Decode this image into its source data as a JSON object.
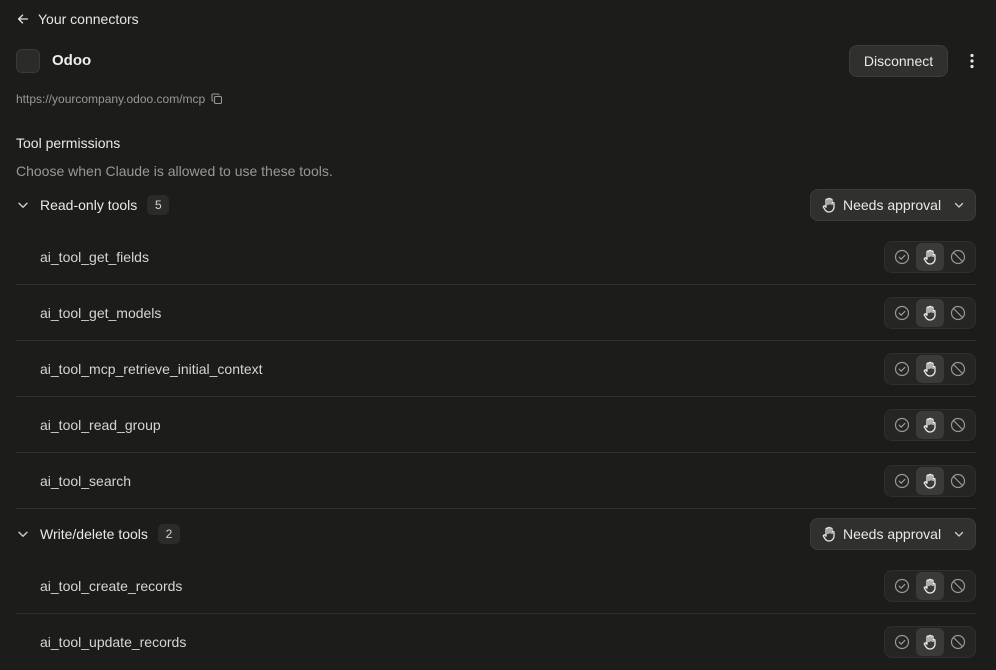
{
  "nav": {
    "back_label": "Your connectors"
  },
  "connector": {
    "name": "Odoo",
    "disconnect_label": "Disconnect",
    "url": "https://yourcompany.odoo.com/mcp"
  },
  "permissions": {
    "title": "Tool permissions",
    "subtitle": "Choose when Claude is allowed to use these tools."
  },
  "groups": [
    {
      "label": "Read-only tools",
      "count": "5",
      "policy": "Needs approval",
      "tools": [
        {
          "name": "ai_tool_get_fields",
          "selected": "approval"
        },
        {
          "name": "ai_tool_get_models",
          "selected": "approval"
        },
        {
          "name": "ai_tool_mcp_retrieve_initial_context",
          "selected": "approval"
        },
        {
          "name": "ai_tool_read_group",
          "selected": "approval"
        },
        {
          "name": "ai_tool_search",
          "selected": "approval"
        }
      ]
    },
    {
      "label": "Write/delete tools",
      "count": "2",
      "policy": "Needs approval",
      "tools": [
        {
          "name": "ai_tool_create_records",
          "selected": "approval"
        },
        {
          "name": "ai_tool_update_records",
          "selected": "approval"
        }
      ]
    }
  ],
  "icons": {
    "back": "arrow-left-icon",
    "more": "vertical-dots-icon",
    "copy": "copy-icon",
    "expand": "chevron-down-icon",
    "allow": "check-circle-icon",
    "approval": "hand-icon",
    "block": "block-icon"
  },
  "colors": {
    "background": "#1c1c1b",
    "button": "#30302e",
    "text": "#e8e6e0",
    "muted": "#9b9891"
  }
}
